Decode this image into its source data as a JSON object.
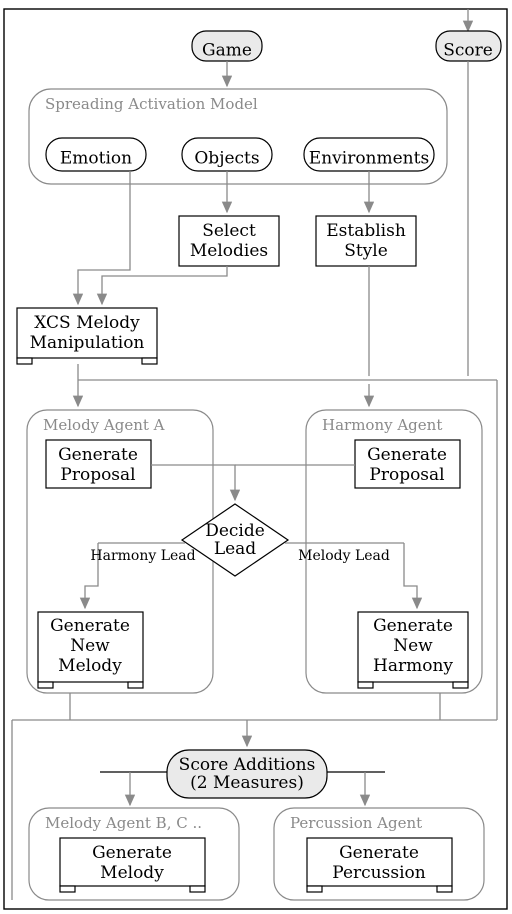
{
  "top": {
    "game": "Game",
    "score": "Score"
  },
  "sam": {
    "title": "Spreading Activation Model",
    "emotion": "Emotion",
    "objects": "Objects",
    "environments": "Environments"
  },
  "steps": {
    "select": {
      "l1": "Select",
      "l2": "Melodies"
    },
    "style": {
      "l1": "Establish",
      "l2": "Style"
    },
    "xcs": {
      "l1": "XCS Melody",
      "l2": "Manipulation"
    }
  },
  "agents": {
    "melodyA": {
      "title": "Melody Agent A",
      "proposal": {
        "l1": "Generate",
        "l2": "Proposal"
      },
      "newmel": {
        "l1": "Generate",
        "l2": "New",
        "l3": "Melody"
      }
    },
    "harmony": {
      "title": "Harmony Agent",
      "proposal": {
        "l1": "Generate",
        "l2": "Proposal"
      },
      "newharm": {
        "l1": "Generate",
        "l2": "New",
        "l3": "Harmony"
      }
    }
  },
  "decide": {
    "l1": "Decide",
    "l2": "Lead"
  },
  "edges": {
    "harmonyLead": "Harmony Lead",
    "melodyLead": "Melody Lead"
  },
  "scoreAdd": {
    "l1": "Score Additions",
    "l2": "(2 Measures)"
  },
  "bottom": {
    "melodyBC": {
      "title": "Melody Agent B, C ..",
      "l1": "Generate",
      "l2": "Melody"
    },
    "perc": {
      "title": "Percussion Agent",
      "l1": "Generate",
      "l2": "Percussion"
    }
  },
  "chart_data": {
    "type": "flowchart",
    "nodes": [
      {
        "id": "game",
        "label": "Game",
        "shape": "rounded",
        "fill": "#eaeaea"
      },
      {
        "id": "score",
        "label": "Score",
        "shape": "rounded",
        "fill": "#eaeaea"
      },
      {
        "id": "sam",
        "label": "Spreading Activation Model",
        "shape": "panel",
        "children": [
          "emotion",
          "objects",
          "environments"
        ]
      },
      {
        "id": "emotion",
        "label": "Emotion",
        "shape": "rounded"
      },
      {
        "id": "objects",
        "label": "Objects",
        "shape": "rounded"
      },
      {
        "id": "environments",
        "label": "Environments",
        "shape": "rounded"
      },
      {
        "id": "select",
        "label": "Select Melodies",
        "shape": "rect"
      },
      {
        "id": "style",
        "label": "Establish Style",
        "shape": "rect"
      },
      {
        "id": "xcs",
        "label": "XCS Melody Manipulation",
        "shape": "rect"
      },
      {
        "id": "melodyA",
        "label": "Melody Agent A",
        "shape": "panel"
      },
      {
        "id": "harmonyAgent",
        "label": "Harmony Agent",
        "shape": "panel"
      },
      {
        "id": "genPropA",
        "label": "Generate Proposal",
        "shape": "rect",
        "parent": "melodyA"
      },
      {
        "id": "genPropH",
        "label": "Generate Proposal",
        "shape": "rect",
        "parent": "harmonyAgent"
      },
      {
        "id": "decide",
        "label": "Decide Lead",
        "shape": "diamond"
      },
      {
        "id": "genNewMelody",
        "label": "Generate New Melody",
        "shape": "rect",
        "parent": "melodyA"
      },
      {
        "id": "genNewHarmony",
        "label": "Generate New Harmony",
        "shape": "rect",
        "parent": "harmonyAgent"
      },
      {
        "id": "scoreAdd",
        "label": "Score Additions (2 Measures)",
        "shape": "rounded",
        "fill": "#eaeaea"
      },
      {
        "id": "melodyBC",
        "label": "Melody Agent B, C ..",
        "shape": "panel"
      },
      {
        "id": "percAgent",
        "label": "Percussion Agent",
        "shape": "panel"
      },
      {
        "id": "genMelody",
        "label": "Generate Melody",
        "shape": "rect",
        "parent": "melodyBC"
      },
      {
        "id": "genPerc",
        "label": "Generate Percussion",
        "shape": "rect",
        "parent": "percAgent"
      }
    ],
    "edges": [
      {
        "from": "game",
        "to": "sam"
      },
      {
        "from": "emotion",
        "to": "xcs"
      },
      {
        "from": "objects",
        "to": "select"
      },
      {
        "from": "environments",
        "to": "style"
      },
      {
        "from": "select",
        "to": "xcs"
      },
      {
        "from": "style",
        "to": "harmonyAgent"
      },
      {
        "from": "xcs",
        "to": "melodyA"
      },
      {
        "from": "score",
        "to": "harmonyAgent"
      },
      {
        "from": "genPropA",
        "to": "decide"
      },
      {
        "from": "genPropH",
        "to": "decide"
      },
      {
        "from": "decide",
        "to": "genNewMelody",
        "label": "Harmony Lead"
      },
      {
        "from": "decide",
        "to": "genNewHarmony",
        "label": "Melody Lead"
      },
      {
        "from": "genNewMelody",
        "to": "scoreAdd"
      },
      {
        "from": "genNewHarmony",
        "to": "scoreAdd"
      },
      {
        "from": "melodyA",
        "to": "scoreAdd"
      },
      {
        "from": "harmonyAgent",
        "to": "scoreAdd"
      },
      {
        "from": "scoreAdd",
        "to": "genMelody"
      },
      {
        "from": "scoreAdd",
        "to": "genPerc"
      },
      {
        "from": "melodyBC",
        "to": "score",
        "loop": true
      },
      {
        "from": "percAgent",
        "to": "score",
        "loop": true
      },
      {
        "from": "scoreAdd",
        "to": "score",
        "loop": true
      }
    ]
  }
}
